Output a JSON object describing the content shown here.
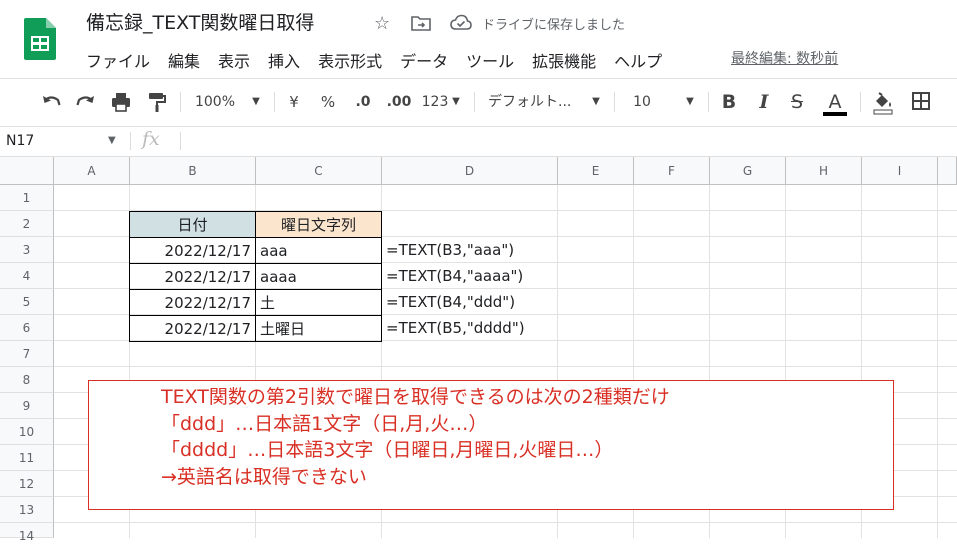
{
  "doc": {
    "title": "備忘録_TEXT関数曜日取得",
    "save_status": "ドライブに保存しました",
    "last_edit": "最終編集: 数秒前"
  },
  "menu": [
    "ファイル",
    "編集",
    "表示",
    "挿入",
    "表示形式",
    "データ",
    "ツール",
    "拡張機能",
    "ヘルプ"
  ],
  "toolbar": {
    "zoom": "100%",
    "currency": "¥",
    "percent": "%",
    "decimal_decrease": ".0",
    "decimal_increase": ".00",
    "number_format": "123",
    "font": "デフォルト...",
    "font_size": "10",
    "bold": "B",
    "italic": "I",
    "strikethrough": "S",
    "text_color": "A"
  },
  "formula_bar": {
    "name_box": "N17",
    "fx": "fx",
    "value": ""
  },
  "columns": [
    "A",
    "B",
    "C",
    "D",
    "E",
    "F",
    "G",
    "H",
    "I"
  ],
  "rows": [
    "1",
    "2",
    "3",
    "4",
    "5",
    "6",
    "7",
    "8",
    "9",
    "10",
    "11",
    "12",
    "13",
    "14"
  ],
  "table": {
    "header_date": "日付",
    "header_weekday": "曜日文字列",
    "header_date_bg": "#d0e0e3",
    "header_weekday_bg": "#fce5cd",
    "rows": [
      {
        "date": "2022/12/17",
        "result": "aaa",
        "formula": "=TEXT(B3,\"aaa\")"
      },
      {
        "date": "2022/12/17",
        "result": "aaaa",
        "formula": "=TEXT(B4,\"aaaa\")"
      },
      {
        "date": "2022/12/17",
        "result": "土",
        "formula": "=TEXT(B4,\"ddd\")"
      },
      {
        "date": "2022/12/17",
        "result": "土曜日",
        "formula": "=TEXT(B5,\"dddd\")"
      }
    ]
  },
  "note": {
    "color": "#d93025",
    "lines": [
      "TEXT関数の第2引数で曜日を取得できるのは次の2種類だけ",
      "「ddd」…日本語1文字（日,月,火…）",
      "「dddd」…日本語3文字（日曜日,月曜日,火曜日…）",
      "→英語名は取得できない"
    ]
  },
  "icons": [
    "sheets-logo-icon",
    "star-icon",
    "move-folder-icon",
    "cloud-saved-icon",
    "undo-icon",
    "redo-icon",
    "print-icon",
    "paint-format-icon",
    "bold-icon",
    "italic-icon",
    "strikethrough-icon",
    "text-color-icon",
    "fill-color-icon",
    "borders-icon"
  ]
}
